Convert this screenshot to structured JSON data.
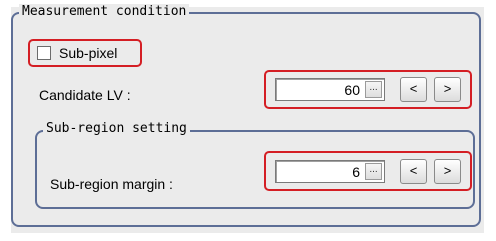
{
  "measurement_condition": {
    "title": "Measurement condition",
    "subpixel_label": "Sub-pixel",
    "subpixel_checked": false,
    "candidate_lv": {
      "label": "Candidate LV :",
      "value": "60",
      "dots_label": "...",
      "dec_label": "<",
      "inc_label": ">"
    }
  },
  "subregion_setting": {
    "title": "Sub-region setting",
    "margin": {
      "label": "Sub-region margin :",
      "value": "6",
      "dots_label": "...",
      "dec_label": "<",
      "inc_label": ">"
    }
  },
  "colors": {
    "group_border": "#5d6e96",
    "highlight": "#d41e24",
    "panel_bg": "#ebebeb"
  }
}
